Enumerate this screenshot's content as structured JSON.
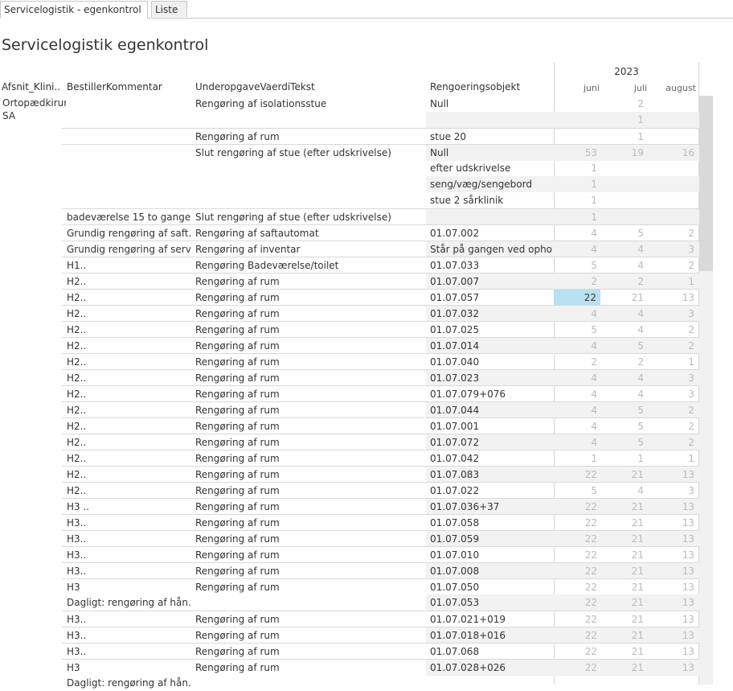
{
  "tabs": [
    {
      "label": "Servicelogistik - egenkontrol",
      "active": true
    },
    {
      "label": "Liste",
      "active": false
    }
  ],
  "page_title": "Servicelogistik egenkontrol",
  "columns": {
    "afsnit": "Afsnit_Klini..",
    "bestiller": "BestillerKommentar",
    "underopgave": "UnderopgaveVaerdiTekst",
    "objekt": "Rengoeringsobjekt",
    "year": "2023",
    "months": [
      "juni",
      "juli",
      "august"
    ]
  },
  "afsnit_value": "Ortopædkirurgi\nSA",
  "colors": {
    "highlight": "#b9e1f1",
    "muted_number": "#bbbbbb",
    "row_band": "#f2f2f2"
  },
  "rows": [
    {
      "b": "",
      "u": "Rengøring af isolationsstue",
      "o": "Null",
      "m": [
        "",
        "2",
        ""
      ],
      "sep": false
    },
    {
      "b": "",
      "u": "",
      "o": "",
      "m": [
        "",
        "1",
        ""
      ],
      "sep": false
    },
    {
      "b": "",
      "u": "Rengøring af rum",
      "o": "stue 20",
      "m": [
        "",
        "1",
        ""
      ],
      "sep": true
    },
    {
      "b": "",
      "u": "Slut rengøring  af stue (efter udskrivelse)",
      "o": "Null",
      "m": [
        "53",
        "19",
        "16"
      ],
      "sep": true
    },
    {
      "b": "",
      "u": "",
      "o": "efter udskrivelse",
      "m": [
        "1",
        "",
        ""
      ],
      "sep": false
    },
    {
      "b": "",
      "u": "",
      "o": "seng/væg/sengebord",
      "m": [
        "1",
        "",
        ""
      ],
      "sep": false
    },
    {
      "b": "",
      "u": "",
      "o": "stue 2 sårklinik",
      "m": [
        "1",
        "",
        ""
      ],
      "sep": false
    },
    {
      "b": "badeværelse 15 to gange",
      "u": "Slut rengøring  af stue (efter udskrivelse)",
      "o": "",
      "m": [
        "1",
        "",
        ""
      ],
      "sep": true
    },
    {
      "b": "Grundig rengøring af saft..",
      "u": "Rengøring af saftautomat",
      "o": "01.07.002",
      "m": [
        "4",
        "5",
        "2"
      ],
      "sep": true
    },
    {
      "b": "Grundig rengøring af serv..",
      "u": "Rengøring af inventar",
      "o": "Står på gangen ved ophol..",
      "m": [
        "4",
        "4",
        "3"
      ],
      "sep": true
    },
    {
      "b": "H1..",
      "u": "Rengøring Badeværelse/toilet",
      "o": "01.07.033",
      "m": [
        "5",
        "4",
        "2"
      ],
      "sep": true
    },
    {
      "b": "H2..",
      "u": "Rengøring af rum",
      "o": "01.07.007",
      "m": [
        "2",
        "2",
        "1"
      ],
      "sep": true
    },
    {
      "b": "H2..",
      "u": "Rengøring af rum",
      "o": "01.07.057",
      "m": [
        "22",
        "21",
        "13"
      ],
      "sep": true,
      "hl": true
    },
    {
      "b": "H2..",
      "u": "Rengøring af rum",
      "o": "01.07.032",
      "m": [
        "4",
        "4",
        "3"
      ],
      "sep": true
    },
    {
      "b": "H2..",
      "u": "Rengøring af rum",
      "o": "01.07.025",
      "m": [
        "5",
        "4",
        "2"
      ],
      "sep": true
    },
    {
      "b": "H2..",
      "u": "Rengøring af rum",
      "o": "01.07.014",
      "m": [
        "4",
        "5",
        "2"
      ],
      "sep": true
    },
    {
      "b": "H2..",
      "u": "Rengøring af rum",
      "o": "01.07.040",
      "m": [
        "2",
        "2",
        "1"
      ],
      "sep": true
    },
    {
      "b": "H2..",
      "u": "Rengøring af rum",
      "o": "01.07.023",
      "m": [
        "4",
        "4",
        "3"
      ],
      "sep": true
    },
    {
      "b": "H2..",
      "u": "Rengøring af rum",
      "o": "01.07.079+076",
      "m": [
        "4",
        "4",
        "3"
      ],
      "sep": true
    },
    {
      "b": "H2..",
      "u": "Rengøring af rum",
      "o": "01.07.044",
      "m": [
        "4",
        "5",
        "2"
      ],
      "sep": true
    },
    {
      "b": "H2..",
      "u": "Rengøring af rum",
      "o": "01.07.001",
      "m": [
        "4",
        "5",
        "2"
      ],
      "sep": true
    },
    {
      "b": "H2..",
      "u": "Rengøring af rum",
      "o": "01.07.072",
      "m": [
        "4",
        "5",
        "2"
      ],
      "sep": true
    },
    {
      "b": "H2..",
      "u": "Rengøring af rum",
      "o": "01.07.042",
      "m": [
        "1",
        "1",
        "1"
      ],
      "sep": true
    },
    {
      "b": "H2..",
      "u": "Rengøring af rum",
      "o": "01.07.083",
      "m": [
        "22",
        "21",
        "13"
      ],
      "sep": true
    },
    {
      "b": "H2..",
      "u": "Rengøring af rum",
      "o": "01.07.022",
      "m": [
        "5",
        "4",
        "3"
      ],
      "sep": true
    },
    {
      "b": "H3 ..",
      "u": "Rengøring af rum",
      "o": "01.07.036+37",
      "m": [
        "22",
        "21",
        "13"
      ],
      "sep": true
    },
    {
      "b": "H3..",
      "u": "Rengøring af rum",
      "o": "01.07.058",
      "m": [
        "22",
        "21",
        "13"
      ],
      "sep": true
    },
    {
      "b": "H3..",
      "u": "Rengøring af rum",
      "o": "01.07.059",
      "m": [
        "22",
        "21",
        "13"
      ],
      "sep": true
    },
    {
      "b": "H3..",
      "u": "Rengøring af rum",
      "o": "01.07.010",
      "m": [
        "22",
        "21",
        "13"
      ],
      "sep": true
    },
    {
      "b": "H3..",
      "u": "Rengøring af rum",
      "o": "01.07.008",
      "m": [
        "22",
        "21",
        "13"
      ],
      "sep": true
    },
    {
      "b": "H3",
      "u": "Rengøring af rum",
      "o": "01.07.050",
      "m": [
        "22",
        "21",
        "13"
      ],
      "sep": true
    },
    {
      "b": "Dagligt: rengøring af hån..",
      "u": "",
      "o": "01.07.053",
      "m": [
        "22",
        "21",
        "13"
      ],
      "sep": false
    },
    {
      "b": "H3..",
      "u": "Rengøring af rum",
      "o": "01.07.021+019",
      "m": [
        "22",
        "21",
        "13"
      ],
      "sep": true
    },
    {
      "b": "H3..",
      "u": "Rengøring af rum",
      "o": "01.07.018+016",
      "m": [
        "22",
        "21",
        "13"
      ],
      "sep": true
    },
    {
      "b": "H3..",
      "u": "Rengøring af rum",
      "o": "01.07.068",
      "m": [
        "22",
        "21",
        "13"
      ],
      "sep": true
    },
    {
      "b": "H3",
      "u": "Rengøring af rum",
      "o": "01.07.028+026",
      "m": [
        "22",
        "21",
        "13"
      ],
      "sep": true
    },
    {
      "b": "Dagligt: rengøring af hån..",
      "u": "",
      "o": "",
      "m": [
        "",
        "",
        ""
      ],
      "sep": false
    }
  ]
}
